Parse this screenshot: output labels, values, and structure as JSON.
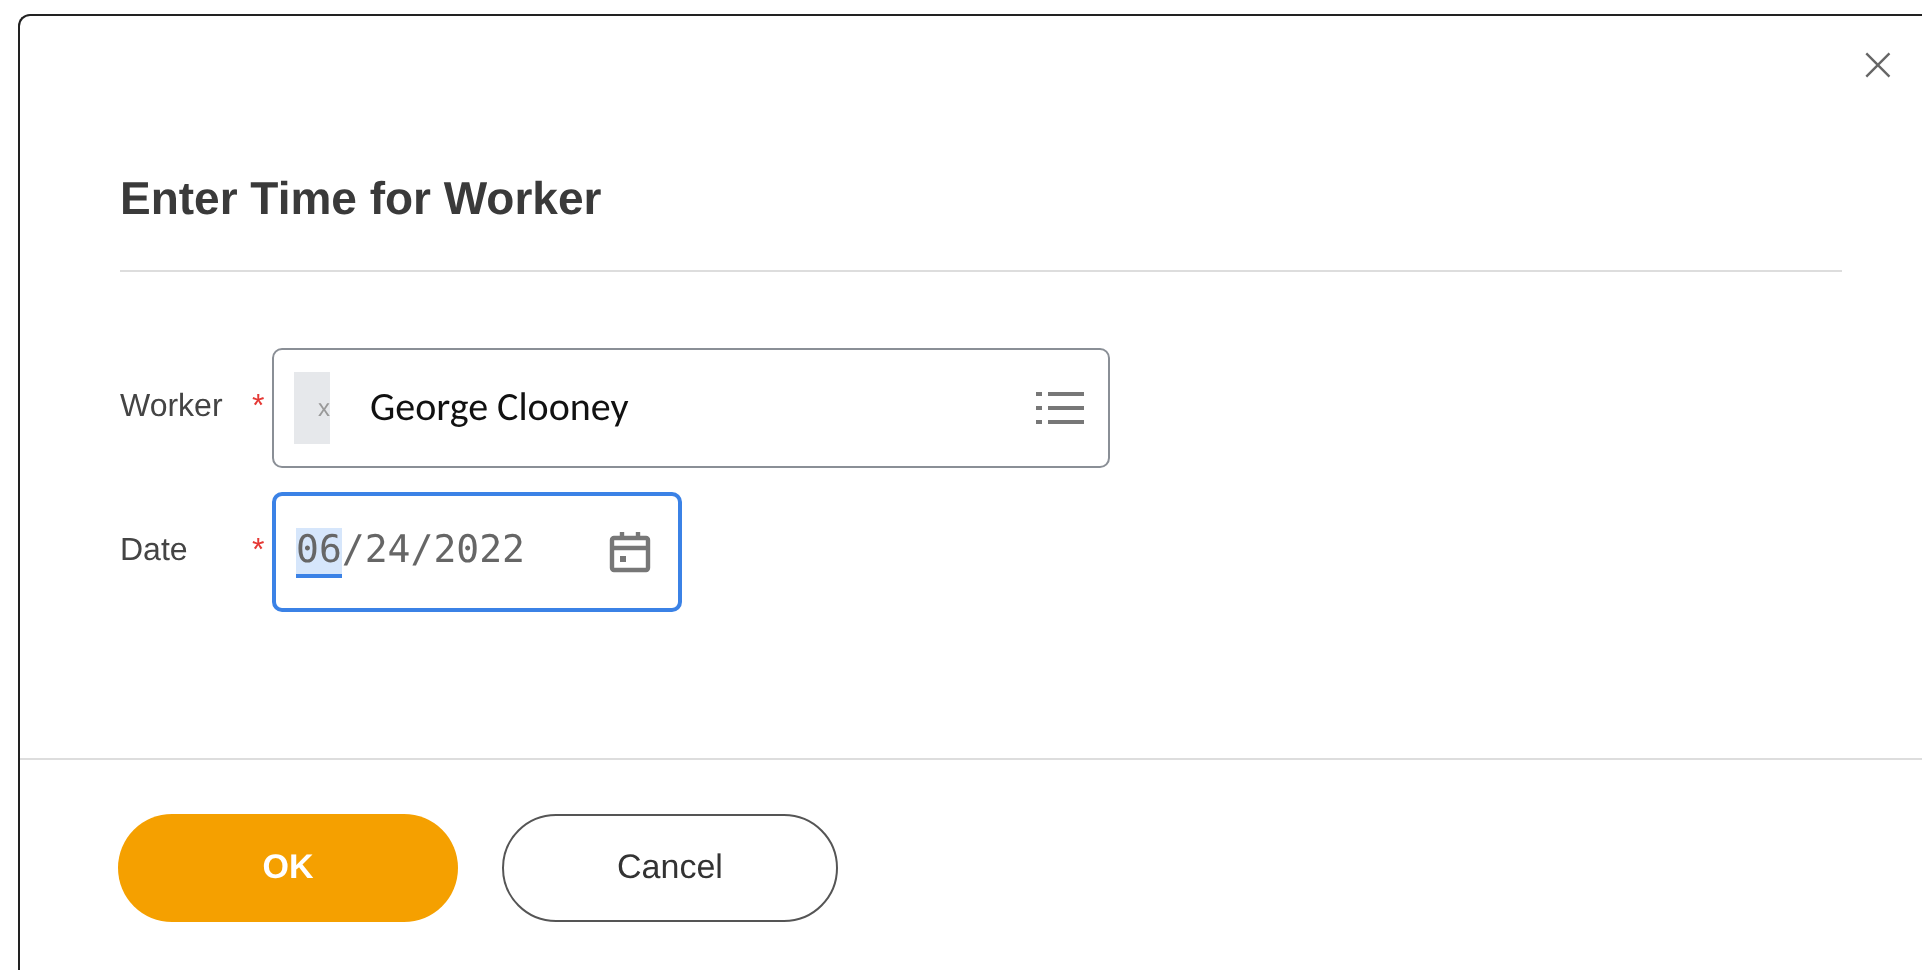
{
  "dialog": {
    "close": "×",
    "title": "Enter Time for Worker"
  },
  "fields": [
    {
      "kind": "prompt",
      "label": "Worker",
      "required_mark": "*",
      "chip_glyph": "x",
      "value": "George Clooney",
      "focused": false
    },
    {
      "kind": "date",
      "label": "Date",
      "required_mark": "*",
      "focused": true,
      "segments": [
        {
          "text": "06",
          "selected": true
        },
        {
          "text": "/",
          "selected": false
        },
        {
          "text": "24",
          "selected": false
        },
        {
          "text": "/",
          "selected": false
        },
        {
          "text": "2022",
          "selected": false
        }
      ]
    }
  ],
  "buttons": [
    {
      "label": "OK",
      "kind": "primary"
    },
    {
      "label": "Cancel",
      "kind": "secondary"
    }
  ]
}
